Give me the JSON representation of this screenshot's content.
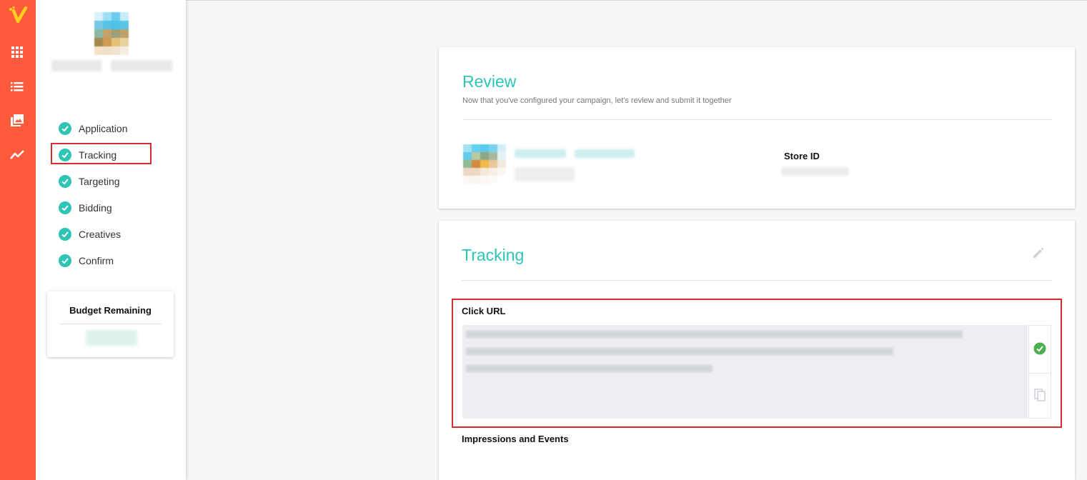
{
  "nav": {
    "icons": [
      "logo-icon",
      "apps-grid-icon",
      "list-icon",
      "gallery-icon",
      "analytics-icon"
    ]
  },
  "steps": [
    {
      "label": "Application"
    },
    {
      "label": "Tracking"
    },
    {
      "label": "Targeting"
    },
    {
      "label": "Bidding"
    },
    {
      "label": "Creatives"
    },
    {
      "label": "Confirm"
    }
  ],
  "budget": {
    "title": "Budget Remaining"
  },
  "review": {
    "title": "Review",
    "subtitle": "Now that you've configured your campaign, let's review and submit it together",
    "store_id_label": "Store ID"
  },
  "tracking": {
    "title": "Tracking",
    "click_url_label": "Click URL",
    "impressions_label": "Impressions and Events"
  },
  "colors": {
    "accent": "#2ec4b6",
    "rail": "#ff5a3c",
    "highlight": "#d32f2f",
    "success": "#4caf50"
  }
}
